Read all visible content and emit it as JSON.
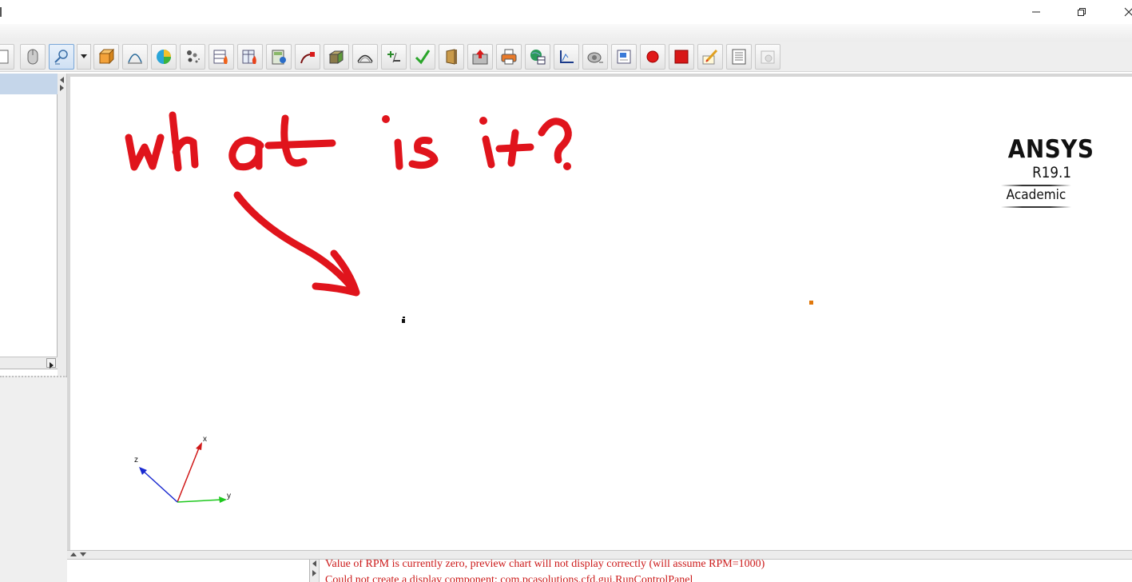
{
  "window": {
    "minimize_icon": "minimize-icon",
    "restore_icon": "restore-icon",
    "close_icon": "close-icon"
  },
  "toolbar": {
    "buttons": [
      {
        "name": "blank-tool",
        "icon": "blank-icon"
      },
      {
        "name": "mouse-mode",
        "icon": "mouse-icon"
      },
      {
        "name": "probe-tool",
        "icon": "probe-icon",
        "active": true
      },
      {
        "name": "geometry",
        "icon": "box-icon"
      },
      {
        "name": "curve",
        "icon": "curve-icon"
      },
      {
        "name": "sphere",
        "icon": "sphere-icon"
      },
      {
        "name": "particles",
        "icon": "particles-icon"
      },
      {
        "name": "heat-table",
        "icon": "heat-table-icon"
      },
      {
        "name": "heat-table-2",
        "icon": "heat-table-2-icon"
      },
      {
        "name": "calculator",
        "icon": "calculator-icon"
      },
      {
        "name": "line-probe",
        "icon": "line-probe-icon"
      },
      {
        "name": "package",
        "icon": "package-icon"
      },
      {
        "name": "contour",
        "icon": "contour-icon"
      },
      {
        "name": "plus-minus",
        "icon": "plus-minus-icon"
      },
      {
        "name": "check",
        "icon": "check-icon"
      },
      {
        "name": "door",
        "icon": "door-icon"
      },
      {
        "name": "upload",
        "icon": "upload-icon"
      },
      {
        "name": "printer",
        "icon": "printer-icon"
      },
      {
        "name": "globe-table",
        "icon": "globe-table-icon"
      },
      {
        "name": "plot-axes",
        "icon": "plot-axes-icon"
      },
      {
        "name": "camera",
        "icon": "camera-icon"
      },
      {
        "name": "image-export",
        "icon": "image-export-icon"
      },
      {
        "name": "record",
        "icon": "record-icon"
      },
      {
        "name": "stop",
        "icon": "stop-icon"
      },
      {
        "name": "edit",
        "icon": "pencil-icon"
      },
      {
        "name": "report",
        "icon": "report-icon"
      },
      {
        "name": "disabled-tool",
        "icon": "disabled-icon"
      }
    ]
  },
  "viewport": {
    "annotation_text": "what is it?",
    "logo": {
      "name": "ANSYS",
      "version": "R19.1",
      "edition": "Academic"
    },
    "axes": {
      "x": "x",
      "y": "y",
      "z": "z"
    }
  },
  "console": {
    "lines": [
      "Value of RPM is currently zero, preview chart will not display correctly (will assume RPM=1000)",
      "Could not create a display component: com.pcasolutions.cfd.gui.RunControlPanel"
    ]
  },
  "colors": {
    "annotation": "#e0141c",
    "console_text": "#cc1a1a",
    "tree_selection": "#c5d6ea",
    "axis_x": "#d01818",
    "axis_y": "#1ec81e",
    "axis_z": "#1a2ad0"
  }
}
